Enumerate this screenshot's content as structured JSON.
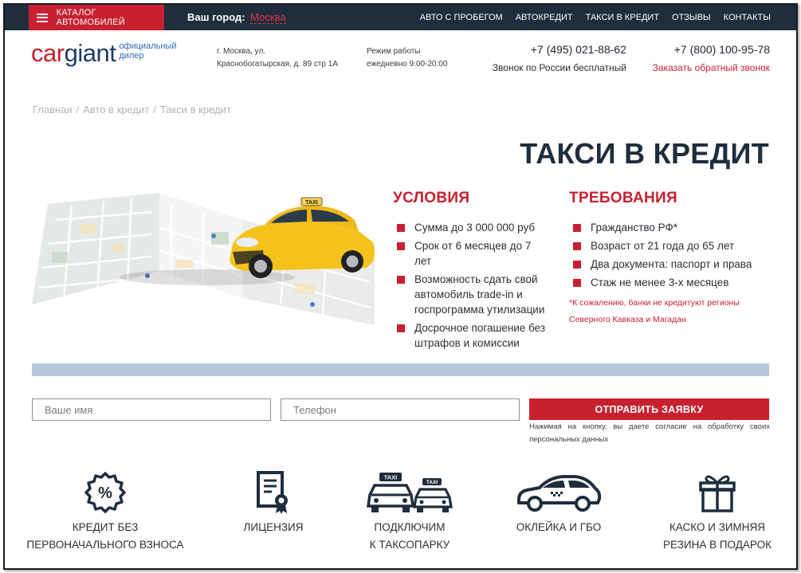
{
  "topbar": {
    "catalog_label": "КАТАЛОГ АВТОМОБИЛЕЙ",
    "city_prefix": "Ваш город:",
    "city_value": "Москва",
    "nav": [
      "АВТО С ПРОБЕГОМ",
      "АВТОКРЕДИТ",
      "ТАКСИ В КРЕДИТ",
      "ОТЗЫВЫ",
      "КОНТАКТЫ"
    ]
  },
  "header": {
    "logo_car": "car",
    "logo_giant": "giant",
    "logo_sub_1": "официальный",
    "logo_sub_2": "дилер",
    "address_1": "г. Москва, ул.",
    "address_2": "Краснобогатырская, д. 89 стр 1А",
    "hours_1": "Режим работы",
    "hours_2": "ежедневно 9:00-20:00",
    "phone_1": "+7 (495) 021-88-62",
    "phone_1_sub": "Звонок по России бесплатный",
    "phone_2": "+7 (800) 100-95-78",
    "phone_2_sub": "Заказать обратный звонок"
  },
  "breadcrumb": [
    "Главная",
    "Авто в кредит",
    "Такси в кредит"
  ],
  "page_title": "ТАКСИ В КРЕДИТ",
  "conditions": {
    "title": "УСЛОВИЯ",
    "items": [
      "Сумма до 3 000 000 руб",
      "Срок от 6 месяцев до 7 лет",
      "Возможность сдать свой автомобиль trade-in и госпрограмма утилизации",
      "Досрочное погашение без штрафов и комиссии"
    ]
  },
  "requirements": {
    "title": "ТРЕБОВАНИЯ",
    "items": [
      "Гражданство РФ*",
      "Возраст от 21 года до 65 лет",
      "Два документа: паспорт и права",
      "Стаж не менее 3-х месяцев"
    ],
    "note": "*К сожалению, банки не кредитуют регионы Северного Кавказа и Магадан"
  },
  "form": {
    "name_placeholder": "Ваше имя",
    "phone_placeholder": "Телефон",
    "submit_label": "ОТПРАВИТЬ ЗАЯВКУ",
    "consent": "Нажимая на кнопку, вы даете согласие на обработку своих персональных данных"
  },
  "features": [
    {
      "icon": "percent-badge-icon",
      "line1": "КРЕДИТ БЕЗ",
      "line2": "ПЕРВОНАЧАЛЬНОГО ВЗНОСА"
    },
    {
      "icon": "license-certificate-icon",
      "line1": "ЛИЦЕНЗИЯ",
      "line2": ""
    },
    {
      "icon": "taxi-cars-icon",
      "line1": "ПОДКЛЮЧИМ",
      "line2": "К ТАКСОПАРКУ"
    },
    {
      "icon": "car-wrap-icon",
      "line1": "ОКЛЕЙКА И ГБО",
      "line2": ""
    },
    {
      "icon": "gift-box-icon",
      "line1": "КАСКО И ЗИМНЯЯ",
      "line2": "РЕЗИНА В ПОДАРОК"
    }
  ],
  "taxi_sign": "TAXI",
  "colors": {
    "brand_red": "#c8202f",
    "navy": "#1f2d3d",
    "light_blue_bar": "#b6cadb"
  }
}
